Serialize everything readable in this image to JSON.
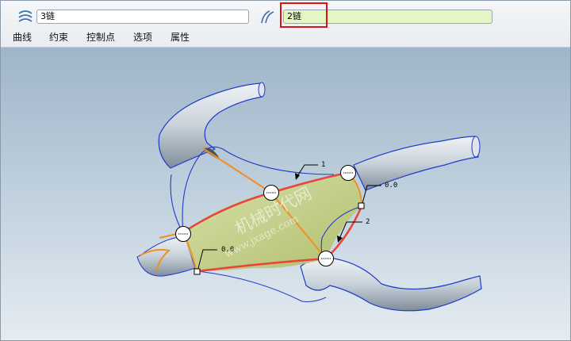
{
  "toolbar": {
    "first_chain": {
      "icon": "curve-chain-icon",
      "value": "3链"
    },
    "second_chain": {
      "icon": "boundary-chain-icon",
      "value": "2链",
      "active": true,
      "highlight_color": "#e01010"
    }
  },
  "tabs": [
    {
      "label": "曲线"
    },
    {
      "label": "约束"
    },
    {
      "label": "控制点"
    },
    {
      "label": "选项"
    },
    {
      "label": "属性"
    }
  ],
  "viewport": {
    "background": [
      "#9fb5c9",
      "#e6ecf1"
    ],
    "surface_color": "#c4cf8a",
    "boundary_color": "#e8463c",
    "guide_color": "#f0901e",
    "tube_color": "#c9d2da",
    "annotations": {
      "chain_1": "1",
      "chain_2": "2",
      "value_right": "0.0",
      "value_left": "0.0"
    },
    "watermark": {
      "title": "机械时代网",
      "url": "www.jxage.com"
    }
  }
}
